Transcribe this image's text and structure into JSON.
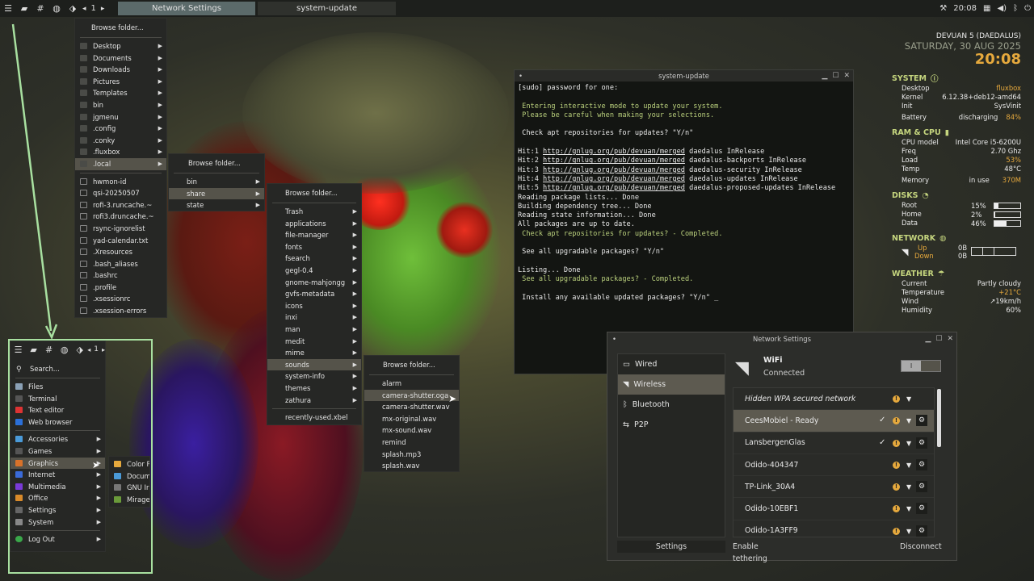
{
  "taskbar": {
    "workspace": "1",
    "prev": "◂",
    "next": "▸",
    "tasks": [
      "Network Settings",
      "system-update"
    ],
    "clock": "20:08"
  },
  "menu_folders": {
    "browse": "Browse folder...",
    "items": [
      "Desktop",
      "Documents",
      "Downloads",
      "Pictures",
      "Templates",
      "bin",
      "jgmenu",
      ".config",
      ".conky",
      ".fluxbox",
      ".local"
    ],
    "files": [
      "hwmon-id",
      "qsi-20250507",
      "rofi-3.runcache.~",
      "rofi3.druncache.~",
      "rsync-ignorelist",
      "yad-calendar.txt",
      ".Xresources",
      ".bash_aliases",
      ".bashrc",
      ".profile",
      ".xsessionrc",
      ".xsession-errors"
    ]
  },
  "menu_local": {
    "browse": "Browse folder...",
    "items": [
      "bin",
      "share",
      "state"
    ]
  },
  "menu_share": {
    "browse": "Browse folder...",
    "items": [
      "Trash",
      "applications",
      "file-manager",
      "fonts",
      "fsearch",
      "gegl-0.4",
      "gnome-mahjongg",
      "gvfs-metadata",
      "icons",
      "inxi",
      "man",
      "medit",
      "mime",
      "sounds",
      "system-info",
      "themes",
      "zathura"
    ],
    "files": [
      "recently-used.xbel"
    ]
  },
  "menu_sounds": {
    "browse": "Browse folder...",
    "files": [
      "alarm",
      "camera-shutter.oga",
      "camera-shutter.wav",
      "mx-original.wav",
      "mx-sound.wav",
      "remind",
      "splash.mp3",
      "splash.wav"
    ]
  },
  "app_menu": {
    "workspace": "1",
    "search": "Search...",
    "apps": [
      "Files",
      "Terminal",
      "Text editor",
      "Web browser"
    ],
    "categories": [
      "Accessories",
      "Games",
      "Graphics",
      "Internet",
      "Multimedia",
      "Office",
      "Settings",
      "System"
    ],
    "logout": "Log Out",
    "submenu": [
      "Color P",
      "Docum",
      "GNU Ir",
      "Mirage"
    ]
  },
  "terminal": {
    "title": "system-update",
    "lines": [
      {
        "t": "[sudo] password for one:",
        "c": ""
      },
      {
        "t": "",
        "c": ""
      },
      {
        "t": " Entering interactive mode to update your system.",
        "c": "g"
      },
      {
        "t": " Please be careful when making your selections.",
        "c": "g"
      },
      {
        "t": "",
        "c": ""
      },
      {
        "t": " Check apt repositories for updates? \"Y/n\"",
        "c": ""
      },
      {
        "t": "",
        "c": ""
      },
      {
        "t": "Hit:1 |http://gnlug.org/pub/devuan/merged| daedalus InRelease",
        "c": ""
      },
      {
        "t": "Hit:2 |http://gnlug.org/pub/devuan/merged| daedalus-backports InRelease",
        "c": ""
      },
      {
        "t": "Hit:3 |http://gnlug.org/pub/devuan/merged| daedalus-security InRelease",
        "c": ""
      },
      {
        "t": "Hit:4 |http://gnlug.org/pub/devuan/merged| daedalus-updates InRelease",
        "c": ""
      },
      {
        "t": "Hit:5 |http://gnlug.org/pub/devuan/merged| daedalus-proposed-updates InRelease",
        "c": ""
      },
      {
        "t": "Reading package lists... Done",
        "c": ""
      },
      {
        "t": "Building dependency tree... Done",
        "c": ""
      },
      {
        "t": "Reading state information... Done",
        "c": ""
      },
      {
        "t": "All packages are up to date.",
        "c": ""
      },
      {
        "t": " Check apt repositories for updates? - Completed.",
        "c": "g"
      },
      {
        "t": "",
        "c": ""
      },
      {
        "t": " See all upgradable packages? \"Y/n\"",
        "c": ""
      },
      {
        "t": "",
        "c": ""
      },
      {
        "t": "Listing... Done",
        "c": ""
      },
      {
        "t": " See all upgradable packages? - Completed.",
        "c": "g"
      },
      {
        "t": "",
        "c": ""
      },
      {
        "t": " Install any available updated packages? \"Y/n\" _",
        "c": ""
      }
    ]
  },
  "conky": {
    "host": "DEVUAN 5 (DAEDALUS)",
    "date": "SATURDAY, 30 AUG 2025",
    "time": "20:08",
    "system": {
      "title": "SYSTEM",
      "rows": [
        [
          "Desktop",
          "fluxbox"
        ],
        [
          "Kernel",
          "6.12.38+deb12-amd64"
        ],
        [
          "Init",
          "SysVinit"
        ]
      ],
      "battery": [
        "Battery",
        "discharging",
        "84%"
      ]
    },
    "cpu": {
      "title": "RAM & CPU",
      "rows": [
        [
          "CPU model",
          "Intel Core i5-6200U"
        ],
        [
          "Freq",
          "2.70 Ghz"
        ],
        [
          "Load",
          "53%"
        ],
        [
          "Temp",
          "48°C"
        ]
      ],
      "memory": [
        "Memory",
        "in use",
        "370M"
      ]
    },
    "disks": {
      "title": "DISKS",
      "rows": [
        [
          "Root",
          "15%",
          0.15
        ],
        [
          "Home",
          "2%",
          0.02
        ],
        [
          "Data",
          "46%",
          0.46
        ]
      ]
    },
    "network": {
      "title": "NETWORK",
      "up": "Up",
      "down": "Down",
      "up_val": "0B",
      "down_val": "0B"
    },
    "weather": {
      "title": "WEATHER",
      "rows": [
        [
          "Current",
          "Partly cloudy"
        ],
        [
          "Temperature",
          "+21°C"
        ],
        [
          "Wind",
          "↗19km/h"
        ],
        [
          "Humidity",
          "60%"
        ]
      ]
    }
  },
  "netsettings": {
    "title": "Network Settings",
    "nav": [
      "Wired",
      "Wireless",
      "Bluetooth",
      "P2P"
    ],
    "wifi_label": "WiFi",
    "wifi_status": "Connected",
    "toggle": "I",
    "networks": [
      "Hidden WPA secured network",
      "CeesMobiel - Ready",
      "LansbergenGlas",
      "Odido-404347",
      "TP-Link_30A4",
      "Odido-10EBF1",
      "Odido-1A3FF9"
    ],
    "settings_btn": "Settings",
    "tether_btn": "Enable tethering",
    "disconnect_btn": "Disconnect"
  }
}
